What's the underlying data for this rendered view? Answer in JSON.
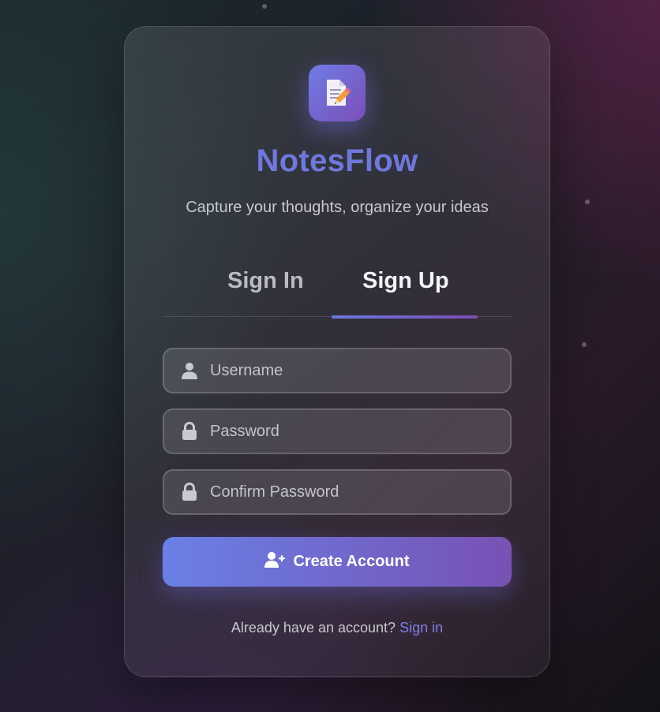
{
  "app": {
    "name": "NotesFlow",
    "tagline": "Capture your thoughts, organize your ideas",
    "logo_icon": "note-pencil-icon"
  },
  "tabs": {
    "items": [
      {
        "label": "Sign In",
        "active": false
      },
      {
        "label": "Sign Up",
        "active": true
      }
    ],
    "accent_gradient": [
      "#6879e0",
      "#7b4db0"
    ]
  },
  "form": {
    "fields": [
      {
        "icon": "user-icon",
        "placeholder": "Username",
        "value": ""
      },
      {
        "icon": "lock-icon",
        "placeholder": "Password",
        "value": ""
      },
      {
        "icon": "lock-icon",
        "placeholder": "Confirm Password",
        "value": ""
      }
    ],
    "submit": {
      "icon": "user-plus-icon",
      "label": "Create Account"
    }
  },
  "footer": {
    "prompt": "Already have an account?",
    "link_label": "Sign in"
  },
  "colors": {
    "brand": "#6f78dd",
    "link": "#7e7ee6",
    "button_gradient": [
      "#6a80e6",
      "#7752b3"
    ]
  }
}
